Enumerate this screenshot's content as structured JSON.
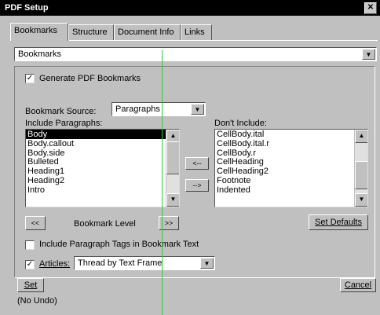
{
  "window": {
    "title": "PDF Setup",
    "close_label": "✕"
  },
  "tabs": [
    "Bookmarks",
    "Structure",
    "Document Info",
    "Links"
  ],
  "section_select": {
    "value": "Bookmarks"
  },
  "generate_bookmarks": {
    "label": "Generate PDF Bookmarks",
    "checked": true
  },
  "bookmark_source": {
    "label": "Bookmark Source:",
    "value": "Paragraphs"
  },
  "include_paragraphs": {
    "label": "Include Paragraphs:",
    "items": [
      "Body",
      "Body.callout",
      "Body.side",
      "Bulleted",
      "Heading1",
      "Heading2",
      "Intro"
    ],
    "selected_index": 0
  },
  "dont_include": {
    "label": "Don't Include:",
    "items": [
      "CellBody.ital",
      "CellBody.ital.r",
      "CellBody.r",
      "CellHeading",
      "CellHeading2",
      "Footnote",
      "Indented"
    ]
  },
  "move_buttons": {
    "add": "<--",
    "remove": "-->"
  },
  "bookmark_level": {
    "left": "<<",
    "label": "Bookmark Level",
    "right": ">>"
  },
  "set_defaults": {
    "label": "Set Defaults"
  },
  "include_tags": {
    "label": "Include Paragraph Tags in Bookmark Text",
    "checked": false
  },
  "articles": {
    "label": "Articles:",
    "checked": true,
    "value": "Thread by Text Frame"
  },
  "footer": {
    "set": "Set",
    "status": "(No Undo)",
    "cancel": "Cancel"
  },
  "colors": {
    "dialog": "#c0c0c0",
    "title_bar": "#000000",
    "guide_line": "#2ecc40"
  },
  "icons": {
    "dropdown": "chevron-down-icon",
    "scroll_up": "arrow-up-icon",
    "scroll_down": "arrow-down-icon"
  }
}
